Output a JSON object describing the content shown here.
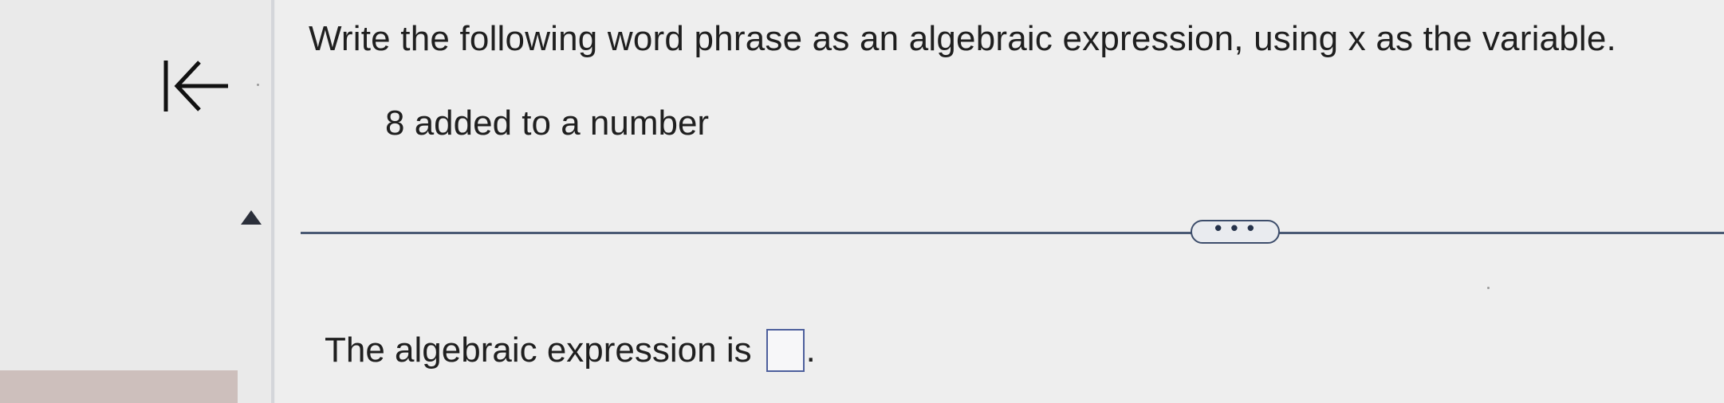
{
  "question": {
    "instruction": "Write the following word phrase as an algebraic expression, using x as the variable.",
    "phrase": "8 added to a number"
  },
  "answer": {
    "prefix": "The algebraic expression is",
    "value": "",
    "suffix": "."
  },
  "controls": {
    "more_label": "• • •",
    "collapse_icon": "collapse-left-icon",
    "scroll_icon": "triangle-up-icon"
  },
  "colors": {
    "accent": "#4d5f9c",
    "separator": "#4a5a74"
  }
}
